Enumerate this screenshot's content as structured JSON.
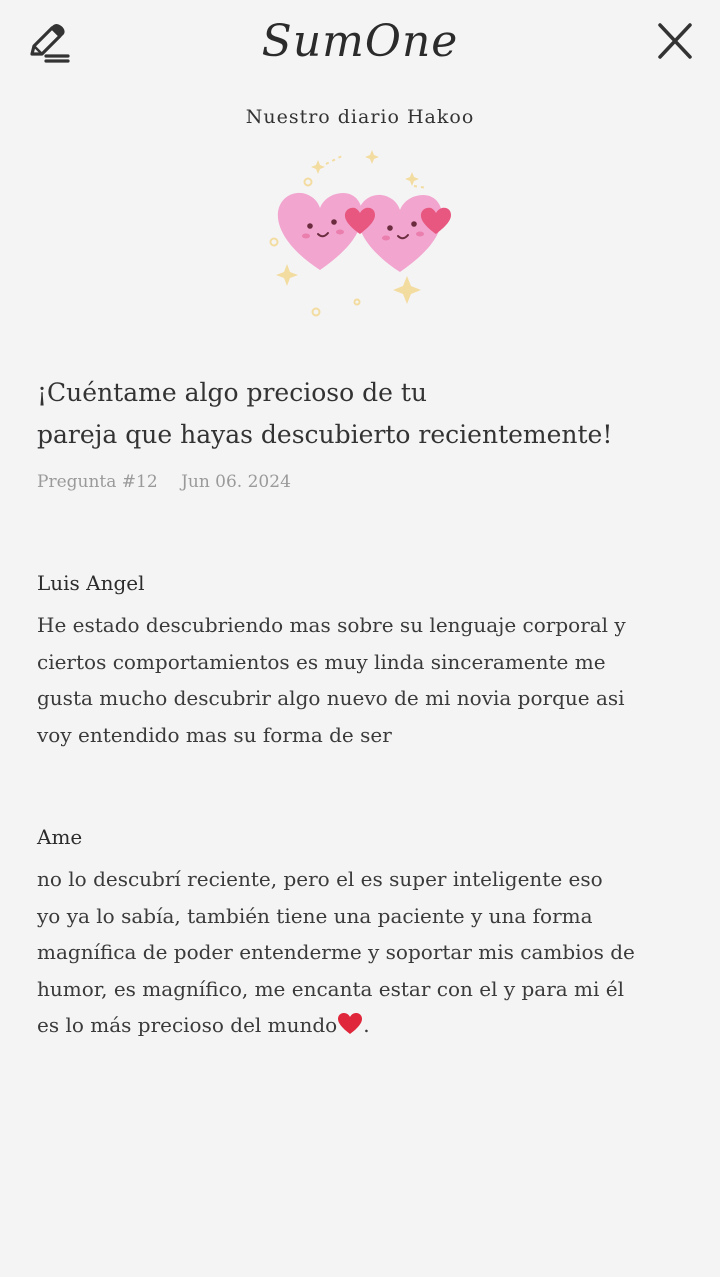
{
  "header": {
    "app_name": "SumOne",
    "diary_title": "Nuestro diario Hakoo"
  },
  "icons": {
    "edit": "pencil-edit-icon",
    "close": "close-x-icon",
    "illustration": "two-pink-hearts-illustration",
    "inline_heart": "red-heart-emoji"
  },
  "colors": {
    "background": "#f4f4f5",
    "heart_pink": "#f2a6cf",
    "heart_accent": "#e8577f",
    "sparkle": "#f3dca0",
    "meta_gray": "#9a9a9a"
  },
  "question": {
    "line1": "¡Cuéntame algo precioso de tu",
    "line2": "pareja que hayas descubierto recientemente!",
    "number": "Pregunta #12",
    "date": "Jun 06. 2024"
  },
  "answers": [
    {
      "author": "Luis Angel",
      "lines": [
        "He estado descubriendo mas sobre su lenguaje corporal y",
        "ciertos comportamientos es muy linda sinceramente me",
        "gusta mucho descubrir algo nuevo de mi novia porque asi",
        "voy entendido mas su forma de ser"
      ]
    },
    {
      "author": "Ame",
      "lines": [
        "no lo descubrí reciente, pero el es super inteligente eso",
        "yo ya lo sabía, también tiene una paciente y una forma",
        "magnífica de poder entenderme y soportar mis cambios de",
        "humor, es magnífico, me encanta estar con el y para mi él",
        "es lo más precioso del mundo"
      ],
      "trailing": "."
    }
  ]
}
